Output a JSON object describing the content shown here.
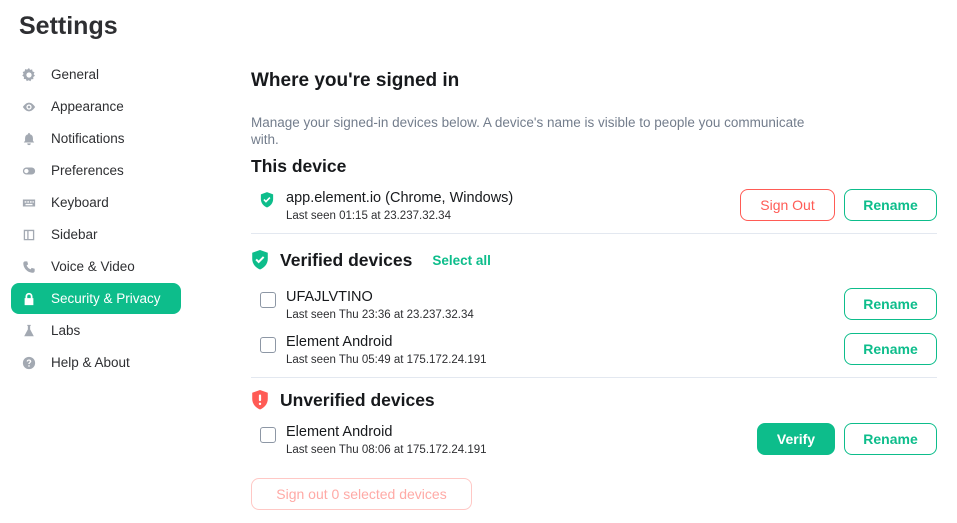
{
  "page_title": "Settings",
  "sidebar": {
    "items": [
      {
        "label": "General",
        "icon": "gear-icon"
      },
      {
        "label": "Appearance",
        "icon": "eye-icon"
      },
      {
        "label": "Notifications",
        "icon": "bell-icon"
      },
      {
        "label": "Preferences",
        "icon": "toggle-icon"
      },
      {
        "label": "Keyboard",
        "icon": "keyboard-icon"
      },
      {
        "label": "Sidebar",
        "icon": "sidebar-icon"
      },
      {
        "label": "Voice & Video",
        "icon": "phone-icon"
      },
      {
        "label": "Security & Privacy",
        "icon": "lock-icon",
        "active": true
      },
      {
        "label": "Labs",
        "icon": "flask-icon"
      },
      {
        "label": "Help & About",
        "icon": "help-icon"
      }
    ]
  },
  "main": {
    "heading": "Where you're signed in",
    "description": "Manage your signed-in devices below. A device's name is visible to people you communicate with.",
    "this_device": {
      "heading": "This device",
      "name": "app.element.io (Chrome, Windows)",
      "meta": "Last seen 01:15 at 23.237.32.34",
      "sign_out_label": "Sign Out",
      "rename_label": "Rename"
    },
    "verified": {
      "heading": "Verified devices",
      "select_all_label": "Select all",
      "devices": [
        {
          "name": "UFAJLVTINO",
          "meta": "Last seen Thu 23:36 at 23.237.32.34",
          "rename_label": "Rename"
        },
        {
          "name": "Element Android",
          "meta": "Last seen Thu 05:49 at 175.172.24.191",
          "rename_label": "Rename"
        }
      ]
    },
    "unverified": {
      "heading": "Unverified devices",
      "devices": [
        {
          "name": "Element Android",
          "meta": "Last seen Thu 08:06 at 175.172.24.191",
          "verify_label": "Verify",
          "rename_label": "Rename"
        }
      ]
    },
    "sign_out_selected_label": "Sign out 0 selected devices"
  },
  "colors": {
    "accent": "#0dbd8b",
    "danger": "#ff5b55",
    "muted_text": "#737d8c"
  }
}
